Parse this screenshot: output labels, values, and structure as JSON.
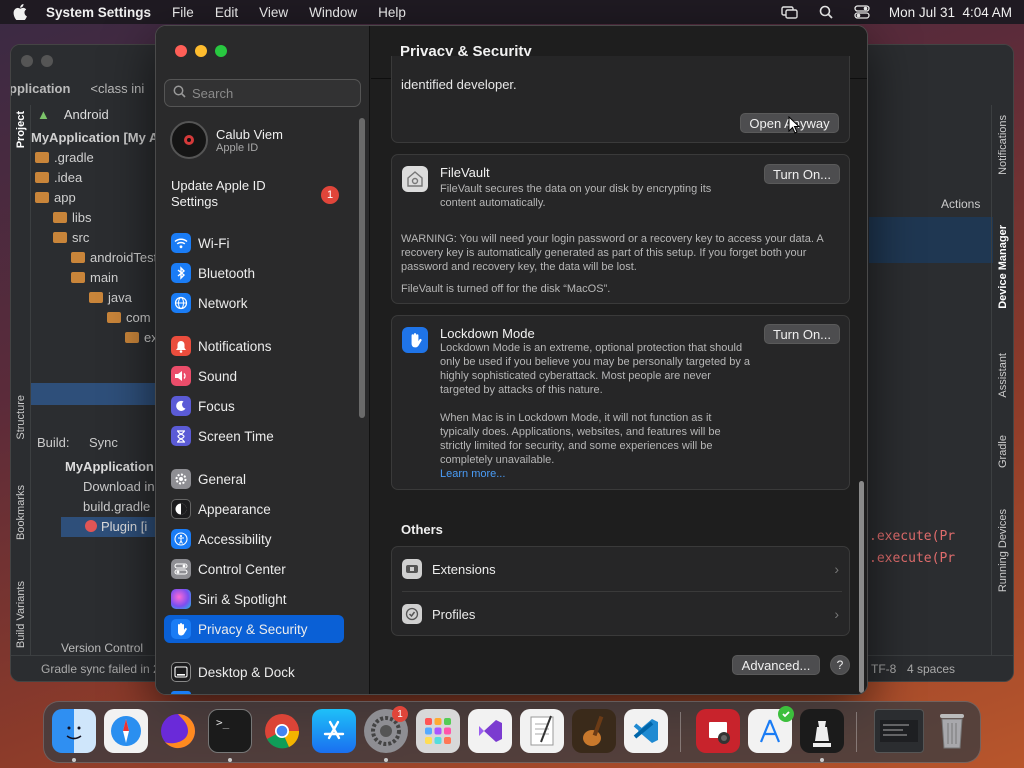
{
  "menubar": {
    "app_name": "System Settings",
    "menus": [
      "File",
      "Edit",
      "View",
      "Window",
      "Help"
    ],
    "clock": "Mon Jul 31  4:04 AM",
    "icons": [
      "apple-icon",
      "screen-mirroring-icon",
      "spotlight-search-icon",
      "control-center-icon"
    ]
  },
  "ide": {
    "breadcrumb": [
      "pplication",
      "<class ini"
    ],
    "view_selector": "Android",
    "tree": [
      {
        "label": "MyApplication [My A",
        "depth": 0,
        "folder": false
      },
      {
        "label": ".gradle",
        "depth": 1,
        "folder": true
      },
      {
        "label": ".idea",
        "depth": 1,
        "folder": true
      },
      {
        "label": "app",
        "depth": 1,
        "folder": true
      },
      {
        "label": "libs",
        "depth": 2,
        "folder": true
      },
      {
        "label": "src",
        "depth": 2,
        "folder": true
      },
      {
        "label": "androidTest",
        "depth": 3,
        "folder": true
      },
      {
        "label": "main",
        "depth": 3,
        "folder": true
      },
      {
        "label": "java",
        "depth": 4,
        "folder": true
      },
      {
        "label": "com",
        "depth": 5,
        "folder": true
      },
      {
        "label": "ex",
        "depth": 6,
        "folder": true
      }
    ],
    "left_tabs": [
      "Project",
      "Structure",
      "Bookmarks",
      "Build Variants"
    ],
    "right_tabs": [
      "Notifications",
      "Device Manager",
      "Assistant",
      "Gradle",
      "Running Devices"
    ],
    "build_tab": "Build:",
    "sync_tab": "Sync",
    "build_tree": [
      "MyApplication",
      "Download in",
      "build.gradle",
      "Plugin [i"
    ],
    "actions_label": "Actions",
    "code_lines": [
      ".execute(Pr",
      ".execute(Pr"
    ],
    "version_control": "Version Control",
    "status_text": "Gradle sync failed in 2",
    "encoding": "TF-8",
    "indent": "4 spaces"
  },
  "settings": {
    "search_placeholder": "Search",
    "account": {
      "name": "Calub Viem",
      "subtitle": "Apple ID"
    },
    "update": {
      "label": "Update Apple ID Settings",
      "badge": "1"
    },
    "sidebar_items": [
      {
        "label": "Wi-Fi",
        "icon": "wifi-icon",
        "color": "#1a7cf5"
      },
      {
        "label": "Bluetooth",
        "icon": "bluetooth-icon",
        "color": "#1a7cf5"
      },
      {
        "label": "Network",
        "icon": "globe-icon",
        "color": "#1a7cf5"
      },
      {
        "label": "Notifications",
        "icon": "bell-icon",
        "color": "#eb4d3d"
      },
      {
        "label": "Sound",
        "icon": "speaker-icon",
        "color": "#eb4d6a"
      },
      {
        "label": "Focus",
        "icon": "moon-icon",
        "color": "#5b5bd6"
      },
      {
        "label": "Screen Time",
        "icon": "hourglass-icon",
        "color": "#5b5bd6"
      },
      {
        "label": "General",
        "icon": "gear-icon",
        "color": "#8e8e93"
      },
      {
        "label": "Appearance",
        "icon": "appearance-icon",
        "color": "#1c1c1e"
      },
      {
        "label": "Accessibility",
        "icon": "accessibility-icon",
        "color": "#1a7cf5"
      },
      {
        "label": "Control Center",
        "icon": "control-center-icon",
        "color": "#8e8e93"
      },
      {
        "label": "Siri & Spotlight",
        "icon": "siri-icon",
        "color": "#b44fd9"
      },
      {
        "label": "Privacy & Security",
        "icon": "hand-icon",
        "color": "#1a7cf5"
      },
      {
        "label": "Desktop & Dock",
        "icon": "dock-icon",
        "color": "#1c1c1e"
      }
    ],
    "content": {
      "title": "Privacy & Security",
      "top_text": "identified developer.",
      "open_anyway": "Open Anyway",
      "filevault": {
        "title": "FileVault",
        "description": "FileVault secures the data on your disk by encrypting its content automatically.",
        "button": "Turn On...",
        "warning": "WARNING: You will need your login password or a recovery key to access your data. A recovery key is automatically generated as part of this setup. If you forget both your password and recovery key, the data will be lost.",
        "status": "FileVault is turned off for the disk “MacOS”."
      },
      "lockdown": {
        "title": "Lockdown Mode",
        "description": "Lockdown Mode is an extreme, optional protection that should only be used if you believe you may be personally targeted by a highly sophisticated cyberattack. Most people are never targeted by attacks of this nature.",
        "description2": "When Mac is in Lockdown Mode, it will not function as it typically does. Applications, websites, and features will be strictly limited for security, and some experiences will be completely unavailable.",
        "learn_more": "Learn more...",
        "button": "Turn On..."
      },
      "others_title": "Others",
      "others": [
        {
          "label": "Extensions",
          "icon": "extensions-icon"
        },
        {
          "label": "Profiles",
          "icon": "profiles-icon"
        }
      ],
      "advanced": "Advanced...",
      "help": "?"
    }
  },
  "dock": {
    "apps": [
      {
        "name": "Finder",
        "icon": "finder-icon",
        "color": "#3aa3f5",
        "running": true
      },
      {
        "name": "Safari",
        "icon": "safari-icon",
        "color": "#f2f2f2",
        "running": false
      },
      {
        "name": "Firefox",
        "icon": "firefox-icon",
        "color": "#6a2ad9",
        "running": false
      },
      {
        "name": "Terminal",
        "icon": "terminal-icon",
        "color": "#1b1b1b",
        "running": true
      },
      {
        "name": "Chrome",
        "icon": "chrome-icon",
        "color": "#f2f2f2",
        "running": false
      },
      {
        "name": "App Store",
        "icon": "app-store-icon",
        "color": "#1a8cf5",
        "running": false
      },
      {
        "name": "System Settings",
        "icon": "system-settings-icon",
        "color": "#8e8e93",
        "running": true,
        "badge": "1"
      },
      {
        "name": "Launchpad",
        "icon": "launchpad-icon",
        "color": "#d8d8d8",
        "running": false
      },
      {
        "name": "Visual Studio",
        "icon": "visual-studio-icon",
        "color": "#f2f2f2",
        "running": false
      },
      {
        "name": "TextEdit",
        "icon": "textedit-icon",
        "color": "#f2f2f2",
        "running": false
      },
      {
        "name": "GarageBand",
        "icon": "garageband-icon",
        "color": "#3a2a1a",
        "running": false
      },
      {
        "name": "VS Code",
        "icon": "vscode-icon",
        "color": "#f2f2f2",
        "running": false
      },
      {
        "name": "Photo Booth",
        "icon": "photo-booth-icon",
        "color": "#c8232c",
        "running": false
      },
      {
        "name": "Xcode Instruments",
        "icon": "instruments-icon",
        "color": "#f2f2f2",
        "running": false
      },
      {
        "name": "Chess",
        "icon": "chess-icon",
        "color": "#1b1b1b",
        "running": true
      },
      {
        "name": "Android Studio Window",
        "icon": "window-preview-icon",
        "color": "#2b2d30",
        "running": false
      },
      {
        "name": "Trash",
        "icon": "trash-icon",
        "color": "#b8b8bc",
        "running": false
      }
    ]
  }
}
